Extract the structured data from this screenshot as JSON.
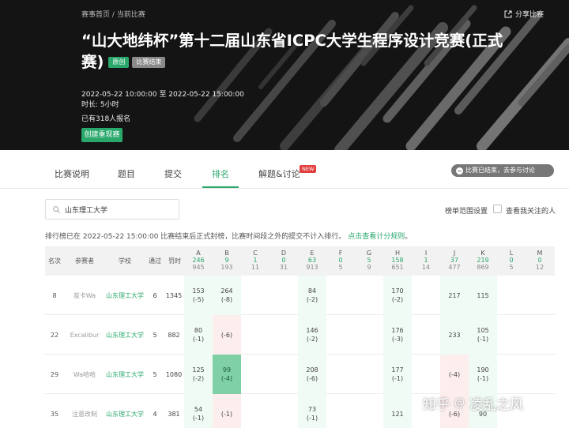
{
  "banner": {
    "breadcrumb": [
      "赛事首页",
      "当前比赛"
    ],
    "breadcrumb_sep": "/",
    "share_label": "分享比赛",
    "title": "“山大地纬杯”第十二届山东省ICPC大学生程序设计竞赛(正式赛)",
    "badge_type": "原创",
    "badge_status": "比赛结束",
    "time_range": "2022-05-22 10:00:00 至 2022-05-22 15:00:00",
    "duration": "时长: 5小时",
    "registered": "已有318人报名",
    "create_label": "创建重现赛"
  },
  "tabs": [
    {
      "label": "比赛说明"
    },
    {
      "label": "题目"
    },
    {
      "label": "提交"
    },
    {
      "label": "排名"
    },
    {
      "label": "解题&讨论"
    }
  ],
  "active_tab": "排名",
  "new_tag": "NEW",
  "ended_notice": "比赛已结束，去参与讨论",
  "search": {
    "value": "山东理工大学",
    "placeholder": ""
  },
  "scope_label": "榜单范围设置",
  "follow_label": "查看我关注的人",
  "notice": {
    "text": "排行榜已在 2022-05-22 15:00:00 比赛结束后正式封榜，比赛时间段之外的提交不计入排行。",
    "link": "点击查看计分规则",
    "end": "。"
  },
  "table": {
    "headers": {
      "rank": "名次",
      "team": "参赛者",
      "school": "学校",
      "solved": "通过",
      "penalty": "罚时"
    },
    "problems": [
      {
        "label": "A",
        "solved": "246",
        "tried": "945"
      },
      {
        "label": "B",
        "solved": "9",
        "tried": "193"
      },
      {
        "label": "C",
        "solved": "1",
        "tried": "11"
      },
      {
        "label": "D",
        "solved": "0",
        "tried": "31"
      },
      {
        "label": "E",
        "solved": "63",
        "tried": "913"
      },
      {
        "label": "F",
        "solved": "0",
        "tried": "5"
      },
      {
        "label": "G",
        "solved": "5",
        "tried": "9"
      },
      {
        "label": "H",
        "solved": "158",
        "tried": "651"
      },
      {
        "label": "I",
        "solved": "1",
        "tried": "14"
      },
      {
        "label": "J",
        "solved": "37",
        "tried": "477"
      },
      {
        "label": "K",
        "solved": "219",
        "tried": "869"
      },
      {
        "label": "L",
        "solved": "0",
        "tried": "5"
      },
      {
        "label": "M",
        "solved": "0",
        "tried": "12"
      }
    ],
    "rows": [
      {
        "rank": "8",
        "team": "炭卡Wa",
        "school": "山东理工大学",
        "solved": "6",
        "penalty": "1345",
        "cells": [
          {
            "t": "153",
            "a": "(-5)",
            "s": "ac"
          },
          {
            "t": "264",
            "a": "(-8)",
            "s": "ac"
          },
          {
            "t": "",
            "a": "",
            "s": ""
          },
          {
            "t": "",
            "a": "",
            "s": ""
          },
          {
            "t": "84",
            "a": "(-2)",
            "s": "ac"
          },
          {
            "t": "",
            "a": "",
            "s": ""
          },
          {
            "t": "",
            "a": "",
            "s": ""
          },
          {
            "t": "170",
            "a": "(-2)",
            "s": "ac"
          },
          {
            "t": "",
            "a": "",
            "s": ""
          },
          {
            "t": "217",
            "a": "",
            "s": "ac"
          },
          {
            "t": "115",
            "a": "",
            "s": "ac"
          },
          {
            "t": "",
            "a": "",
            "s": ""
          },
          {
            "t": "",
            "a": "",
            "s": ""
          }
        ]
      },
      {
        "rank": "22",
        "team": "Excalibur",
        "school": "山东理工大学",
        "solved": "5",
        "penalty": "882",
        "cells": [
          {
            "t": "80",
            "a": "(-1)",
            "s": "ac"
          },
          {
            "t": "(-6)",
            "a": "",
            "s": "wa"
          },
          {
            "t": "",
            "a": "",
            "s": ""
          },
          {
            "t": "",
            "a": "",
            "s": ""
          },
          {
            "t": "146",
            "a": "(-2)",
            "s": "ac"
          },
          {
            "t": "",
            "a": "",
            "s": ""
          },
          {
            "t": "",
            "a": "",
            "s": ""
          },
          {
            "t": "176",
            "a": "(-3)",
            "s": "ac"
          },
          {
            "t": "",
            "a": "",
            "s": ""
          },
          {
            "t": "233",
            "a": "",
            "s": "ac"
          },
          {
            "t": "105",
            "a": "(-1)",
            "s": "ac"
          },
          {
            "t": "",
            "a": "",
            "s": ""
          },
          {
            "t": "",
            "a": "",
            "s": ""
          }
        ]
      },
      {
        "rank": "29",
        "team": "Wa哈哈",
        "school": "山东理工大学",
        "solved": "5",
        "penalty": "1080",
        "cells": [
          {
            "t": "125",
            "a": "(-2)",
            "s": "ac"
          },
          {
            "t": "99",
            "a": "(-4)",
            "s": "fb"
          },
          {
            "t": "",
            "a": "",
            "s": ""
          },
          {
            "t": "",
            "a": "",
            "s": ""
          },
          {
            "t": "208",
            "a": "(-6)",
            "s": "ac"
          },
          {
            "t": "",
            "a": "",
            "s": ""
          },
          {
            "t": "",
            "a": "",
            "s": ""
          },
          {
            "t": "177",
            "a": "(-1)",
            "s": "ac"
          },
          {
            "t": "",
            "a": "",
            "s": ""
          },
          {
            "t": "(-4)",
            "a": "",
            "s": "wa"
          },
          {
            "t": "190",
            "a": "(-1)",
            "s": "ac"
          },
          {
            "t": "",
            "a": "",
            "s": ""
          },
          {
            "t": "",
            "a": "",
            "s": ""
          }
        ]
      },
      {
        "rank": "35",
        "team": "注意改制",
        "school": "山东理工大学",
        "solved": "4",
        "penalty": "381",
        "cells": [
          {
            "t": "54",
            "a": "(-1)",
            "s": "ac"
          },
          {
            "t": "(-1)",
            "a": "",
            "s": "wa"
          },
          {
            "t": "",
            "a": "",
            "s": ""
          },
          {
            "t": "",
            "a": "",
            "s": ""
          },
          {
            "t": "73",
            "a": "(-1)",
            "s": "ac"
          },
          {
            "t": "",
            "a": "",
            "s": ""
          },
          {
            "t": "",
            "a": "",
            "s": ""
          },
          {
            "t": "121",
            "a": "",
            "s": "ac"
          },
          {
            "t": "",
            "a": "",
            "s": ""
          },
          {
            "t": "(-6)",
            "a": "",
            "s": "wa"
          },
          {
            "t": "90",
            "a": "",
            "s": "ac"
          },
          {
            "t": "",
            "a": "",
            "s": ""
          },
          {
            "t": "",
            "a": "",
            "s": ""
          }
        ]
      }
    ]
  },
  "watermark": {
    "brand": "知乎",
    "at": "@",
    "user": "凌乱之风"
  },
  "colors": {
    "accent": "#2aa86c",
    "banner_bg": "#141414",
    "accepted_bg": "#f1fbf5",
    "first_blood_bg": "#7fd0a5",
    "wrong_bg": "#fdeeee"
  }
}
